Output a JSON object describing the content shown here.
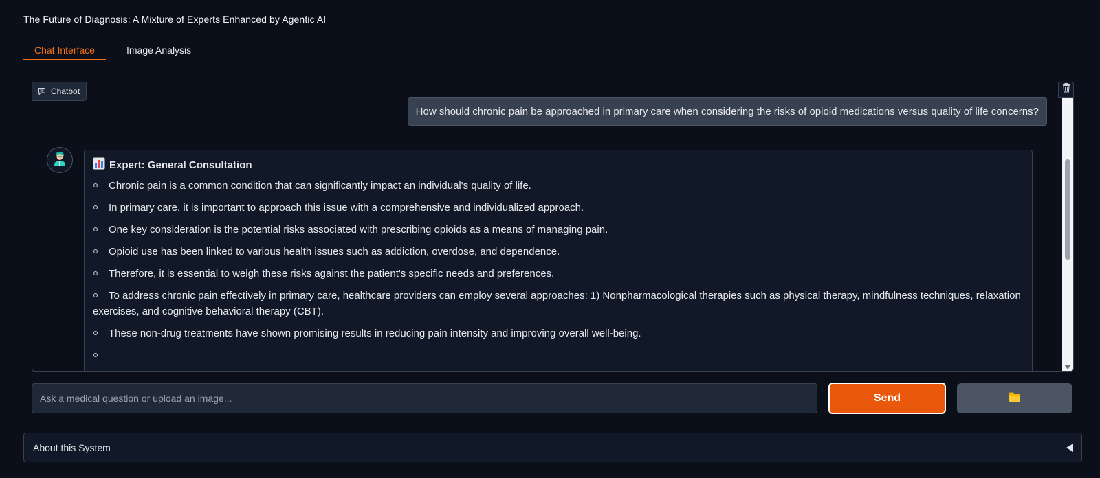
{
  "app": {
    "title": "The Future of Diagnosis: A Mixture of Experts Enhanced by Agentic AI"
  },
  "tabs": [
    {
      "label": "Chat Interface",
      "active": true
    },
    {
      "label": "Image Analysis",
      "active": false
    }
  ],
  "chatbot": {
    "label": "Chatbot",
    "icons": {
      "label": "chat-bubble-icon",
      "clear": "trash-icon",
      "avatar": "doctor-icon",
      "expert": "bar-chart-icon"
    },
    "user_message": "How should chronic pain be approached in primary care when considering the risks of opioid medications versus quality of life concerns?",
    "bot_message": {
      "expert_heading": "Expert: General Consultation",
      "bullets": [
        "Chronic pain is a common condition that can significantly impact an individual's quality of life.",
        "In primary care, it is important to approach this issue with a comprehensive and individualized approach.",
        "One key consideration is the potential risks associated with prescribing opioids as a means of managing pain.",
        "Opioid use has been linked to various health issues such as addiction, overdose, and dependence.",
        "Therefore, it is essential to weigh these risks against the patient's specific needs and preferences.",
        "To address chronic pain effectively in primary care, healthcare providers can employ several approaches: 1) Nonpharmacological therapies such as physical therapy, mindfulness techniques, relaxation exercises, and cognitive behavioral therapy (CBT).",
        "These non-drug treatments have shown promising results in reducing pain intensity and improving overall well-being.",
        ""
      ]
    }
  },
  "input": {
    "placeholder": "Ask a medical question or upload an image...",
    "value": ""
  },
  "buttons": {
    "send_label": "Send",
    "upload_icon": "folder-icon"
  },
  "accordion": {
    "label": "About this System",
    "expanded": false
  },
  "colors": {
    "accent": "#f97316",
    "send_button": "#ea580c",
    "background": "#0b0f19",
    "panel": "#111827"
  }
}
